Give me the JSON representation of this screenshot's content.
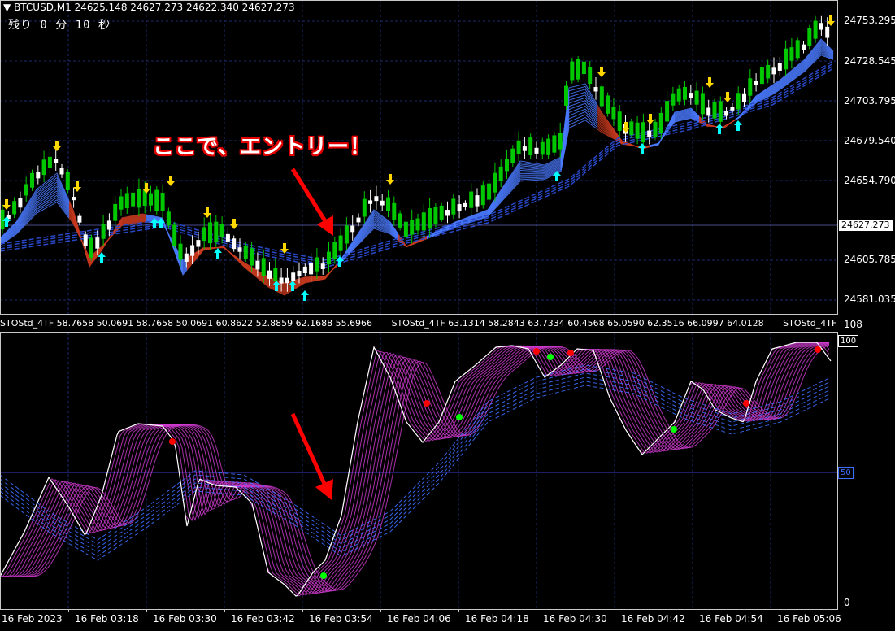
{
  "header": {
    "symbol_line": "BTCUSD,M1  24625.148 24627.273 24622.340 24627.273",
    "timer_text": "残り 0 分 10 秒"
  },
  "annotation": {
    "text": "ここで、エントリー！",
    "color": "#e40000"
  },
  "price_axis": {
    "labels": [
      "24753.295",
      "24728.545",
      "24703.795",
      "24679.540",
      "24654.790",
      "24605.785",
      "24581.035"
    ],
    "current_price": "24627.273"
  },
  "indicator": {
    "header_items": [
      "STOStd_4TF 58.7658 50.0691 58.7658 50.0691 60.8622 52.8859 62.1688 55.6966",
      "STOStd_4TF 63.1314 58.2843 63.7334 60.4568 65.0590 62.3516 66.0997 64.0128",
      "STOStd_4TF"
    ],
    "axis_top": "108",
    "level_100": "100",
    "level_50": "50",
    "axis_bottom": "0"
  },
  "time_axis": {
    "labels": [
      "16 Feb 2023",
      "16 Feb 03:18",
      "16 Feb 03:30",
      "16 Feb 03:42",
      "16 Feb 03:54",
      "16 Feb 04:06",
      "16 Feb 04:18",
      "16 Feb 04:30",
      "16 Feb 04:42",
      "16 Feb 04:54",
      "16 Feb 05:06"
    ]
  },
  "colors": {
    "bull": "#00c800",
    "bear": "#ffffff",
    "grid": "#1e2a6e",
    "buy_arrow": "#00ffff",
    "sell_arrow": "#ffd700",
    "sto_main": "#ffffff",
    "sto_ribbon": "#d23cd2",
    "sto_slow": "#3c6eff",
    "dot_red": "#ff0000",
    "dot_green": "#00ff00"
  }
}
